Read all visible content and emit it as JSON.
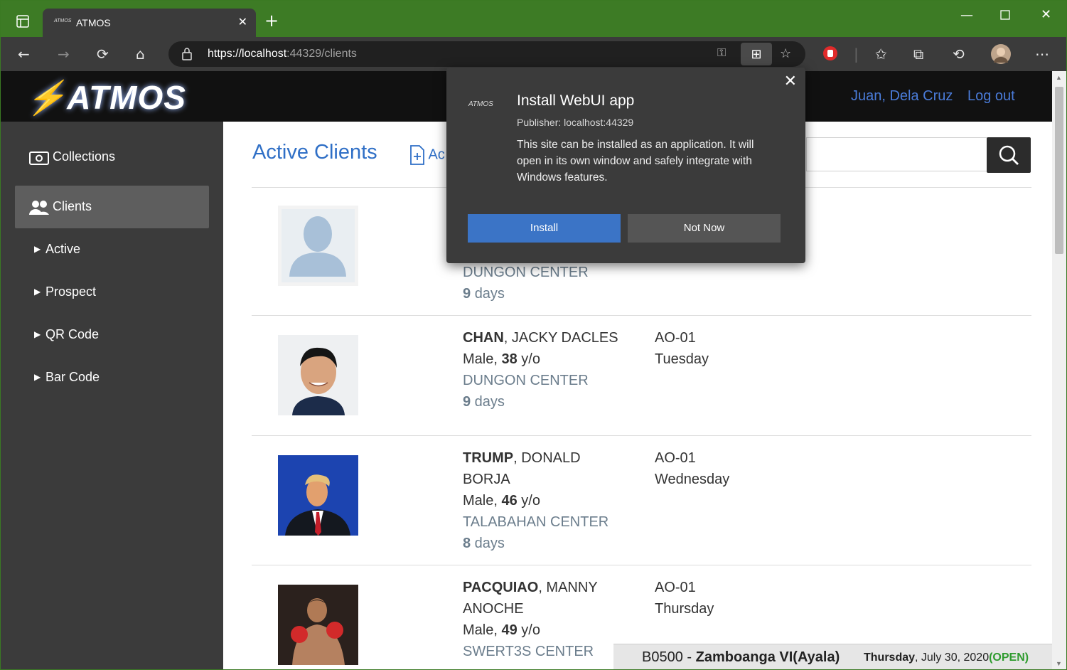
{
  "browser": {
    "tab_title": "ATMOS",
    "tab_favicon_text": "ATMOS",
    "url_host": "https://localhost",
    "url_rest": ":44329/clients"
  },
  "site": {
    "logo": "ATMOS",
    "user_name": "Juan, Dela Cruz",
    "logout": "Log out"
  },
  "sidebar": {
    "items": [
      {
        "label": "Collections",
        "icon": "money-icon"
      },
      {
        "label": "Clients",
        "icon": "users-icon"
      },
      {
        "label": "Active",
        "icon": "caret-right-icon"
      },
      {
        "label": "Prospect",
        "icon": "caret-right-icon"
      },
      {
        "label": "QR Code",
        "icon": "caret-right-icon"
      },
      {
        "label": "Bar Code",
        "icon": "caret-right-icon"
      }
    ]
  },
  "main": {
    "title": "Active Clients",
    "add_label": "Ac"
  },
  "clients": [
    {
      "surname": "",
      "given": "",
      "given2": "",
      "gender": "",
      "age": "",
      "center": "DUNGON CENTER",
      "days": "9",
      "days_unit": "days",
      "officer": "",
      "day": ""
    },
    {
      "surname": "CHAN",
      "given": ", JACKY DACLES",
      "given2": "",
      "gender": "Male, ",
      "age": "38",
      "age_unit": " y/o",
      "center": "DUNGON CENTER",
      "days": "9",
      "days_unit": " days",
      "officer": "AO-01",
      "day": "Tuesday"
    },
    {
      "surname": "TRUMP",
      "given": ", DONALD",
      "given2": "BORJA",
      "gender": "Male, ",
      "age": "46",
      "age_unit": " y/o",
      "center": "TALABAHAN CENTER",
      "days": "8",
      "days_unit": " days",
      "officer": "AO-01",
      "day": "Wednesday"
    },
    {
      "surname": "PACQUIAO",
      "given": ", MANNY",
      "given2": "ANOCHE",
      "gender": "Male, ",
      "age": "49",
      "age_unit": " y/o",
      "center": "SWERT3S CENTER",
      "days": "",
      "days_unit": "",
      "officer": "AO-01",
      "day": "Thursday"
    }
  ],
  "popup": {
    "title": "Install WebUI app",
    "publisher": "Publisher: localhost:44329",
    "description": "This site can be installed as an application. It will open in its own window and safely integrate with Windows features.",
    "install": "Install",
    "not_now": "Not Now",
    "logo": "ATMOS"
  },
  "status": {
    "branch_code": "B0500 - ",
    "branch_name": "Zamboanga VI(Ayala)",
    "weekday": "Thursday",
    "date": ", July 30, 2020",
    "state": "(OPEN)"
  },
  "colors": {
    "titlebar": "#3d7b25",
    "accent": "#2f6fc6",
    "install_button": "#3b74c6",
    "open_status": "#2e9b2e"
  }
}
